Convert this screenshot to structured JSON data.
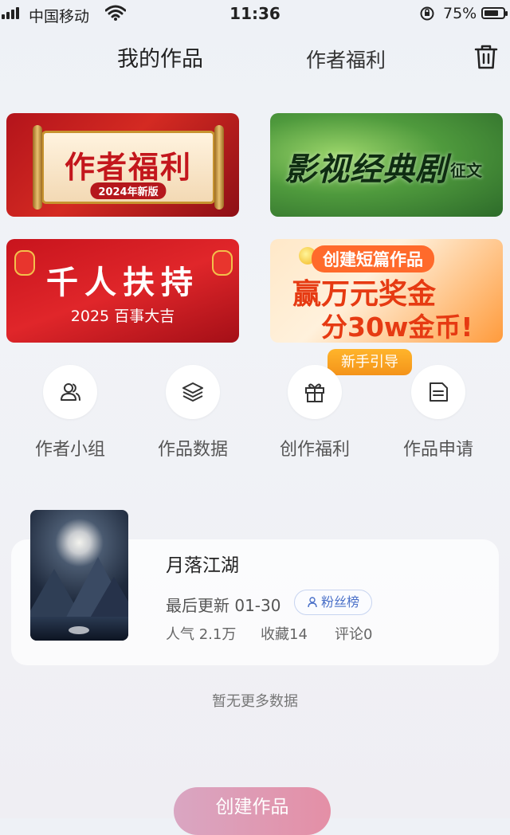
{
  "status_bar": {
    "carrier": "中国移动",
    "time": "11:36",
    "battery": "75%",
    "battery_level": 0.75
  },
  "header": {
    "tab_works": "我的作品",
    "tab_benefits": "作者福利",
    "trash_icon": "trash-icon"
  },
  "banners": [
    {
      "title": "作者福利",
      "tag": "2024年新版"
    },
    {
      "title": "影视经典剧",
      "sub": "征文"
    },
    {
      "title": "千人扶持",
      "sub": "2025 百事大吉"
    },
    {
      "pill": "创建短篇作品",
      "main": "赢万元奖金",
      "sub": "分30w金币!"
    }
  ],
  "newbie_badge": "新手引导",
  "actions": [
    {
      "label": "作者小组",
      "icon": "users-icon"
    },
    {
      "label": "作品数据",
      "icon": "layers-icon"
    },
    {
      "label": "创作福利",
      "icon": "gift-icon"
    },
    {
      "label": "作品申请",
      "icon": "document-icon"
    }
  ],
  "work": {
    "title": "月落江湖",
    "updated": "最后更新 01-30",
    "fans_label": "粉丝榜",
    "popularity": "人气 2.1万",
    "favorites": "收藏14",
    "comments": "评论0"
  },
  "no_more": "暂无更多数据",
  "create_button": "创建作品",
  "colors": {
    "accent_blue": "#4a70c8",
    "orange": "#f4931a",
    "create_button": "#e48fa6"
  }
}
